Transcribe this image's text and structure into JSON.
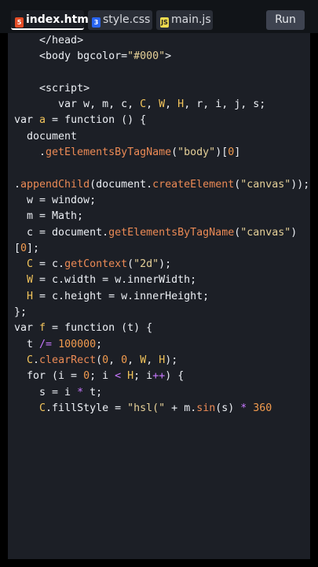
{
  "tabs": [
    {
      "label": "index.html",
      "icon": "html5-icon",
      "active": true
    },
    {
      "label": "style.css",
      "icon": "css3-icon",
      "active": false
    },
    {
      "label": "main.js",
      "icon": "js-icon",
      "active": false
    }
  ],
  "run_label": "Run",
  "code_lines": [
    [
      [
        "    ",
        "p"
      ],
      [
        "</head>",
        "tag"
      ]
    ],
    [
      [
        "    ",
        "p"
      ],
      [
        "<body bgcolor=",
        "tag"
      ],
      [
        "\"#000\"",
        "str"
      ],
      [
        ">",
        "tag"
      ]
    ],
    [
      [
        "",
        "p"
      ]
    ],
    [
      [
        "    ",
        "p"
      ],
      [
        "<script>",
        "tag"
      ]
    ],
    [
      [
        "       var w, m, c, ",
        "kw"
      ],
      [
        "C",
        "id"
      ],
      [
        ", ",
        "p"
      ],
      [
        "W",
        "id"
      ],
      [
        ", ",
        "p"
      ],
      [
        "H",
        "id"
      ],
      [
        ", r, i, j, s;",
        "p"
      ]
    ],
    [
      [
        "var ",
        "kw"
      ],
      [
        "a",
        "id"
      ],
      [
        " = ",
        "p"
      ],
      [
        "function",
        "kw"
      ],
      [
        " () {",
        "p"
      ]
    ],
    [
      [
        "  document",
        "p"
      ]
    ],
    [
      [
        "    .",
        "p"
      ],
      [
        "getElementsByTagName",
        "fn"
      ],
      [
        "(",
        "p"
      ],
      [
        "\"body\"",
        "str"
      ],
      [
        ")[",
        "p"
      ],
      [
        "0",
        "num"
      ],
      [
        "]",
        "p"
      ]
    ],
    [
      [
        "",
        "p"
      ]
    ],
    [
      [
        ".",
        "p"
      ],
      [
        "appendChild",
        "fn"
      ],
      [
        "(document.",
        "p"
      ],
      [
        "createElement",
        "fn"
      ],
      [
        "(",
        "p"
      ],
      [
        "\"canvas\"",
        "str"
      ],
      [
        "));",
        "p"
      ]
    ],
    [
      [
        "  w = window;",
        "p"
      ]
    ],
    [
      [
        "  m = Math;",
        "p"
      ]
    ],
    [
      [
        "  c = document.",
        "p"
      ],
      [
        "getElementsByTagName",
        "fn"
      ],
      [
        "(",
        "p"
      ],
      [
        "\"canvas\"",
        "str"
      ],
      [
        ")",
        "p"
      ]
    ],
    [
      [
        "[",
        "p"
      ],
      [
        "0",
        "num"
      ],
      [
        "];",
        "p"
      ]
    ],
    [
      [
        "  ",
        "p"
      ],
      [
        "C",
        "id"
      ],
      [
        " = c.",
        "p"
      ],
      [
        "getContext",
        "fn"
      ],
      [
        "(",
        "p"
      ],
      [
        "\"2d\"",
        "str"
      ],
      [
        ");",
        "p"
      ]
    ],
    [
      [
        "  ",
        "p"
      ],
      [
        "W",
        "id"
      ],
      [
        " = c.width = w.innerWidth;",
        "p"
      ]
    ],
    [
      [
        "  ",
        "p"
      ],
      [
        "H",
        "id"
      ],
      [
        " = c.height = w.innerHeight;",
        "p"
      ]
    ],
    [
      [
        "};",
        "p"
      ]
    ],
    [
      [
        "var ",
        "kw"
      ],
      [
        "f",
        "id"
      ],
      [
        " = ",
        "p"
      ],
      [
        "function",
        "kw"
      ],
      [
        " (t) {",
        "p"
      ]
    ],
    [
      [
        "  t ",
        "p"
      ],
      [
        "/=",
        "op"
      ],
      [
        " ",
        "p"
      ],
      [
        "100000",
        "num"
      ],
      [
        ";",
        "p"
      ]
    ],
    [
      [
        "  ",
        "p"
      ],
      [
        "C",
        "id"
      ],
      [
        ".",
        "p"
      ],
      [
        "clearRect",
        "fn"
      ],
      [
        "(",
        "p"
      ],
      [
        "0",
        "num"
      ],
      [
        ", ",
        "p"
      ],
      [
        "0",
        "num"
      ],
      [
        ", ",
        "p"
      ],
      [
        "W",
        "id"
      ],
      [
        ", ",
        "p"
      ],
      [
        "H",
        "id"
      ],
      [
        ");",
        "p"
      ]
    ],
    [
      [
        "  for (i = ",
        "p"
      ],
      [
        "0",
        "num"
      ],
      [
        "; i ",
        "p"
      ],
      [
        "<",
        "op"
      ],
      [
        " ",
        "p"
      ],
      [
        "H",
        "id"
      ],
      [
        "; i",
        "p"
      ],
      [
        "++",
        "op"
      ],
      [
        ") {",
        "p"
      ]
    ],
    [
      [
        "    s = i ",
        "p"
      ],
      [
        "*",
        "op"
      ],
      [
        " t;",
        "p"
      ]
    ],
    [
      [
        "    ",
        "p"
      ],
      [
        "C",
        "id"
      ],
      [
        ".fillStyle = ",
        "p"
      ],
      [
        "\"hsl(\"",
        "str"
      ],
      [
        " + m.",
        "p"
      ],
      [
        "sin",
        "fn"
      ],
      [
        "(s) ",
        "p"
      ],
      [
        "*",
        "op"
      ],
      [
        " ",
        "p"
      ],
      [
        "360",
        "num"
      ]
    ]
  ],
  "colors": {
    "background": "#000000",
    "editor_bg": "#1c1f26",
    "tab_active_bg": "#1b1e24",
    "tab_bg": "#2a2e37",
    "html_icon": "#e44d26",
    "css_icon": "#2965f1",
    "js_icon": "#f0db4f"
  }
}
